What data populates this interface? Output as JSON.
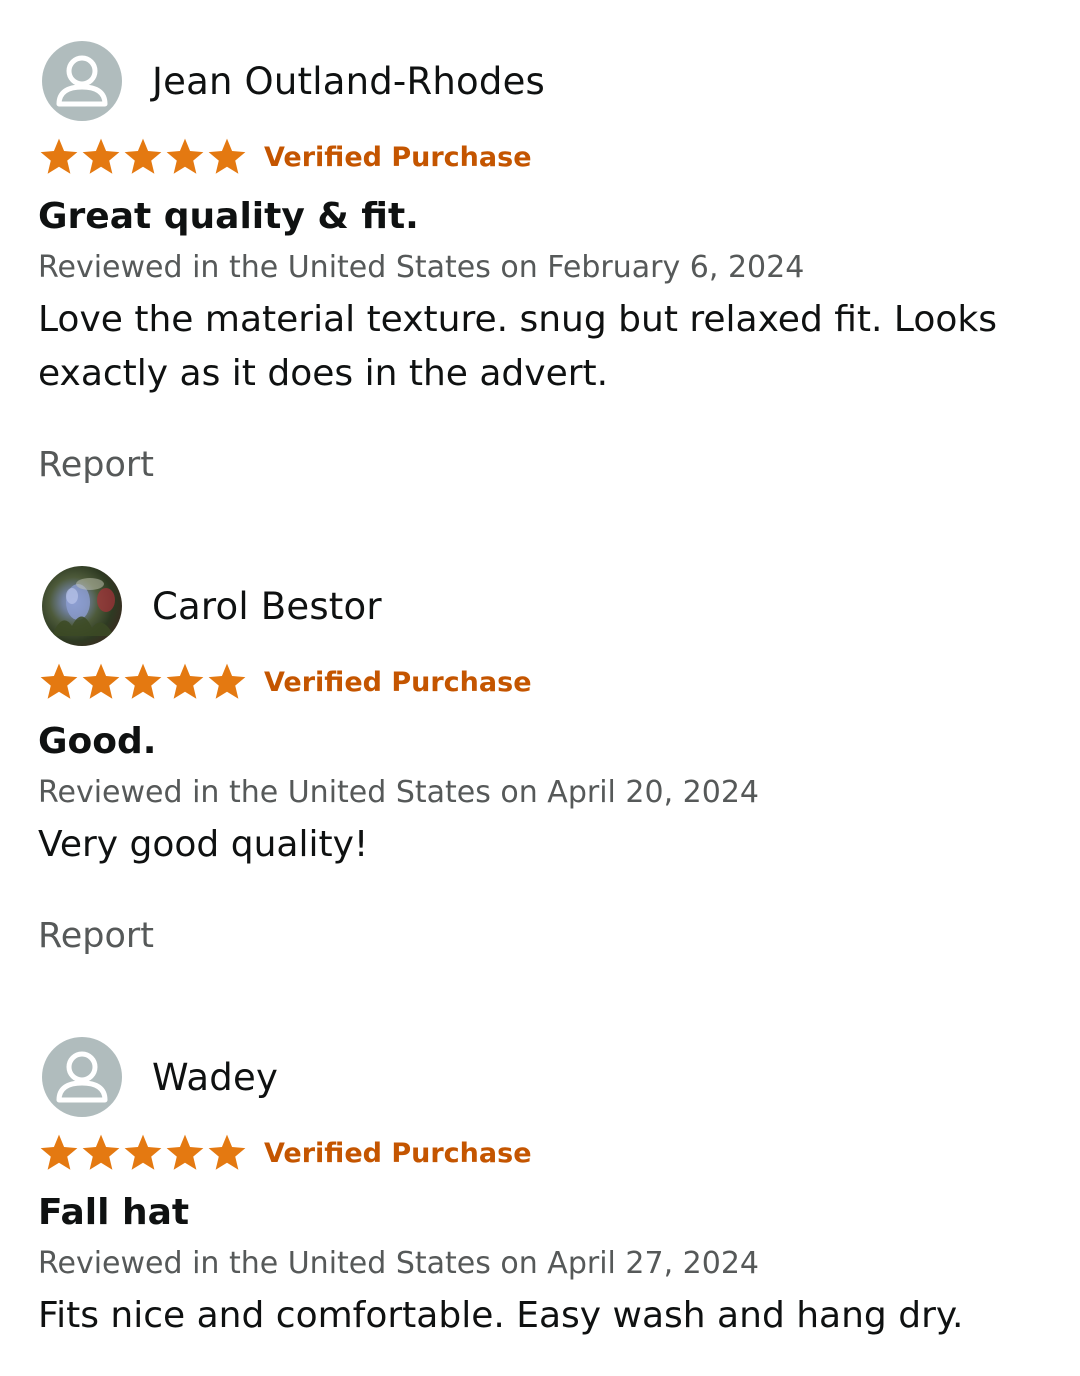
{
  "reviews": [
    {
      "reviewer": "Jean Outland-Rhodes",
      "avatar": "default-user-icon",
      "rating": 5,
      "verified_label": "Verified Purchase",
      "title": "Great quality & fit.",
      "date_line": "Reviewed in the United States on February 6, 2024",
      "body": "Love the material texture. snug but relaxed fit. Looks exactly as it does in the advert.",
      "report_label": "Report"
    },
    {
      "reviewer": "Carol Bestor",
      "avatar": "profile-photo",
      "rating": 5,
      "verified_label": "Verified Purchase",
      "title": "Good.",
      "date_line": "Reviewed in the United States on April 20, 2024",
      "body": "Very good quality!",
      "report_label": "Report"
    },
    {
      "reviewer": "Wadey",
      "avatar": "default-user-icon",
      "rating": 5,
      "verified_label": "Verified Purchase",
      "title": "Fall hat",
      "date_line": "Reviewed in the United States on April 27, 2024",
      "body": "Fits nice and comfortable. Easy wash and hang dry."
    }
  ],
  "colors": {
    "star": "#e47911",
    "verified": "#c45500",
    "secondary_text": "#565959",
    "avatar_bg": "#b0bcbd"
  }
}
